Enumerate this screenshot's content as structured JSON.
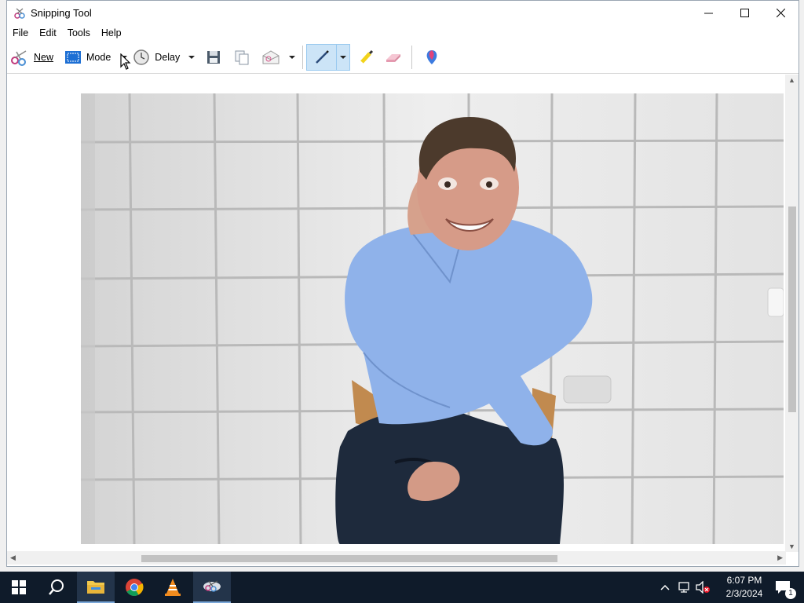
{
  "window": {
    "title": "Snipping Tool",
    "minimize_icon": "minimize-icon",
    "maximize_icon": "maximize-icon",
    "close_icon": "close-icon"
  },
  "menu": [
    "File",
    "Edit",
    "Tools",
    "Help"
  ],
  "toolbar": {
    "new_label": "New",
    "mode_label": "Mode",
    "delay_label": "Delay",
    "icons": [
      "scissors-icon",
      "rectangle-snip-icon",
      "clock-icon",
      "save-icon",
      "copy-icon",
      "send-email-icon",
      "pen-icon",
      "highlighter-icon",
      "eraser-icon",
      "paint3d-icon"
    ],
    "pen_active": true
  },
  "content": {
    "image_icon": "captured-photo"
  },
  "taskbar": {
    "apps": [
      "start-icon",
      "search-icon",
      "file-explorer-icon",
      "chrome-icon",
      "vlc-icon",
      "snipping-tool-icon"
    ],
    "active_app": "snipping-tool-icon",
    "tray_icons": [
      "chevron-up-icon",
      "network-icon",
      "volume-muted-icon",
      "notifications-icon"
    ],
    "time": "6:07 PM",
    "date": "2/3/2024",
    "notification_count": "1"
  },
  "colors": {
    "accent": "#0078d7",
    "taskbar": "#0f1b2a",
    "toolbar_active": "#cce4f7"
  }
}
